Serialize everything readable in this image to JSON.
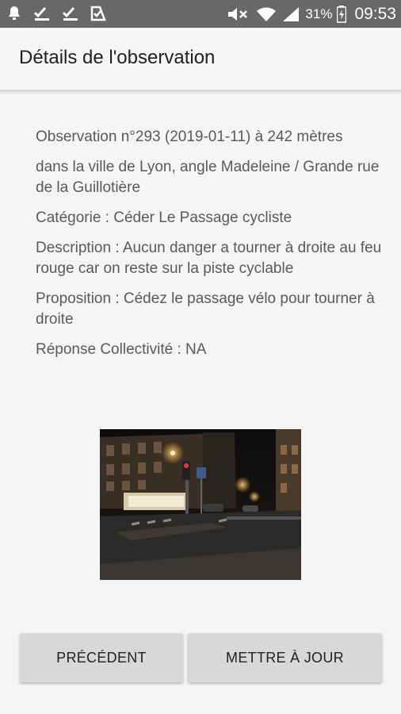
{
  "status_bar": {
    "left_icons": [
      "notification-icon",
      "check-icon",
      "check-icon",
      "task-icon"
    ],
    "battery_percent": "31%",
    "time": "09:53"
  },
  "app_bar": {
    "title": "Détails de l'observation"
  },
  "observation": {
    "header": "Observation n°293 (2019-01-11) à 242 mètres",
    "location": "dans la ville de Lyon, angle Madeleine / Grande rue de la Guillotière",
    "category": "Catégorie : Céder Le Passage cycliste",
    "description": "Description : Aucun danger a tourner à droite au feu rouge car on reste sur la piste cyclable",
    "proposition": "Proposition : Cédez le passage vélo pour tourner à droite",
    "response": "Réponse Collectivité : NA"
  },
  "buttons": {
    "previous": "PRÉCÉDENT",
    "update": "METTRE À JOUR"
  }
}
